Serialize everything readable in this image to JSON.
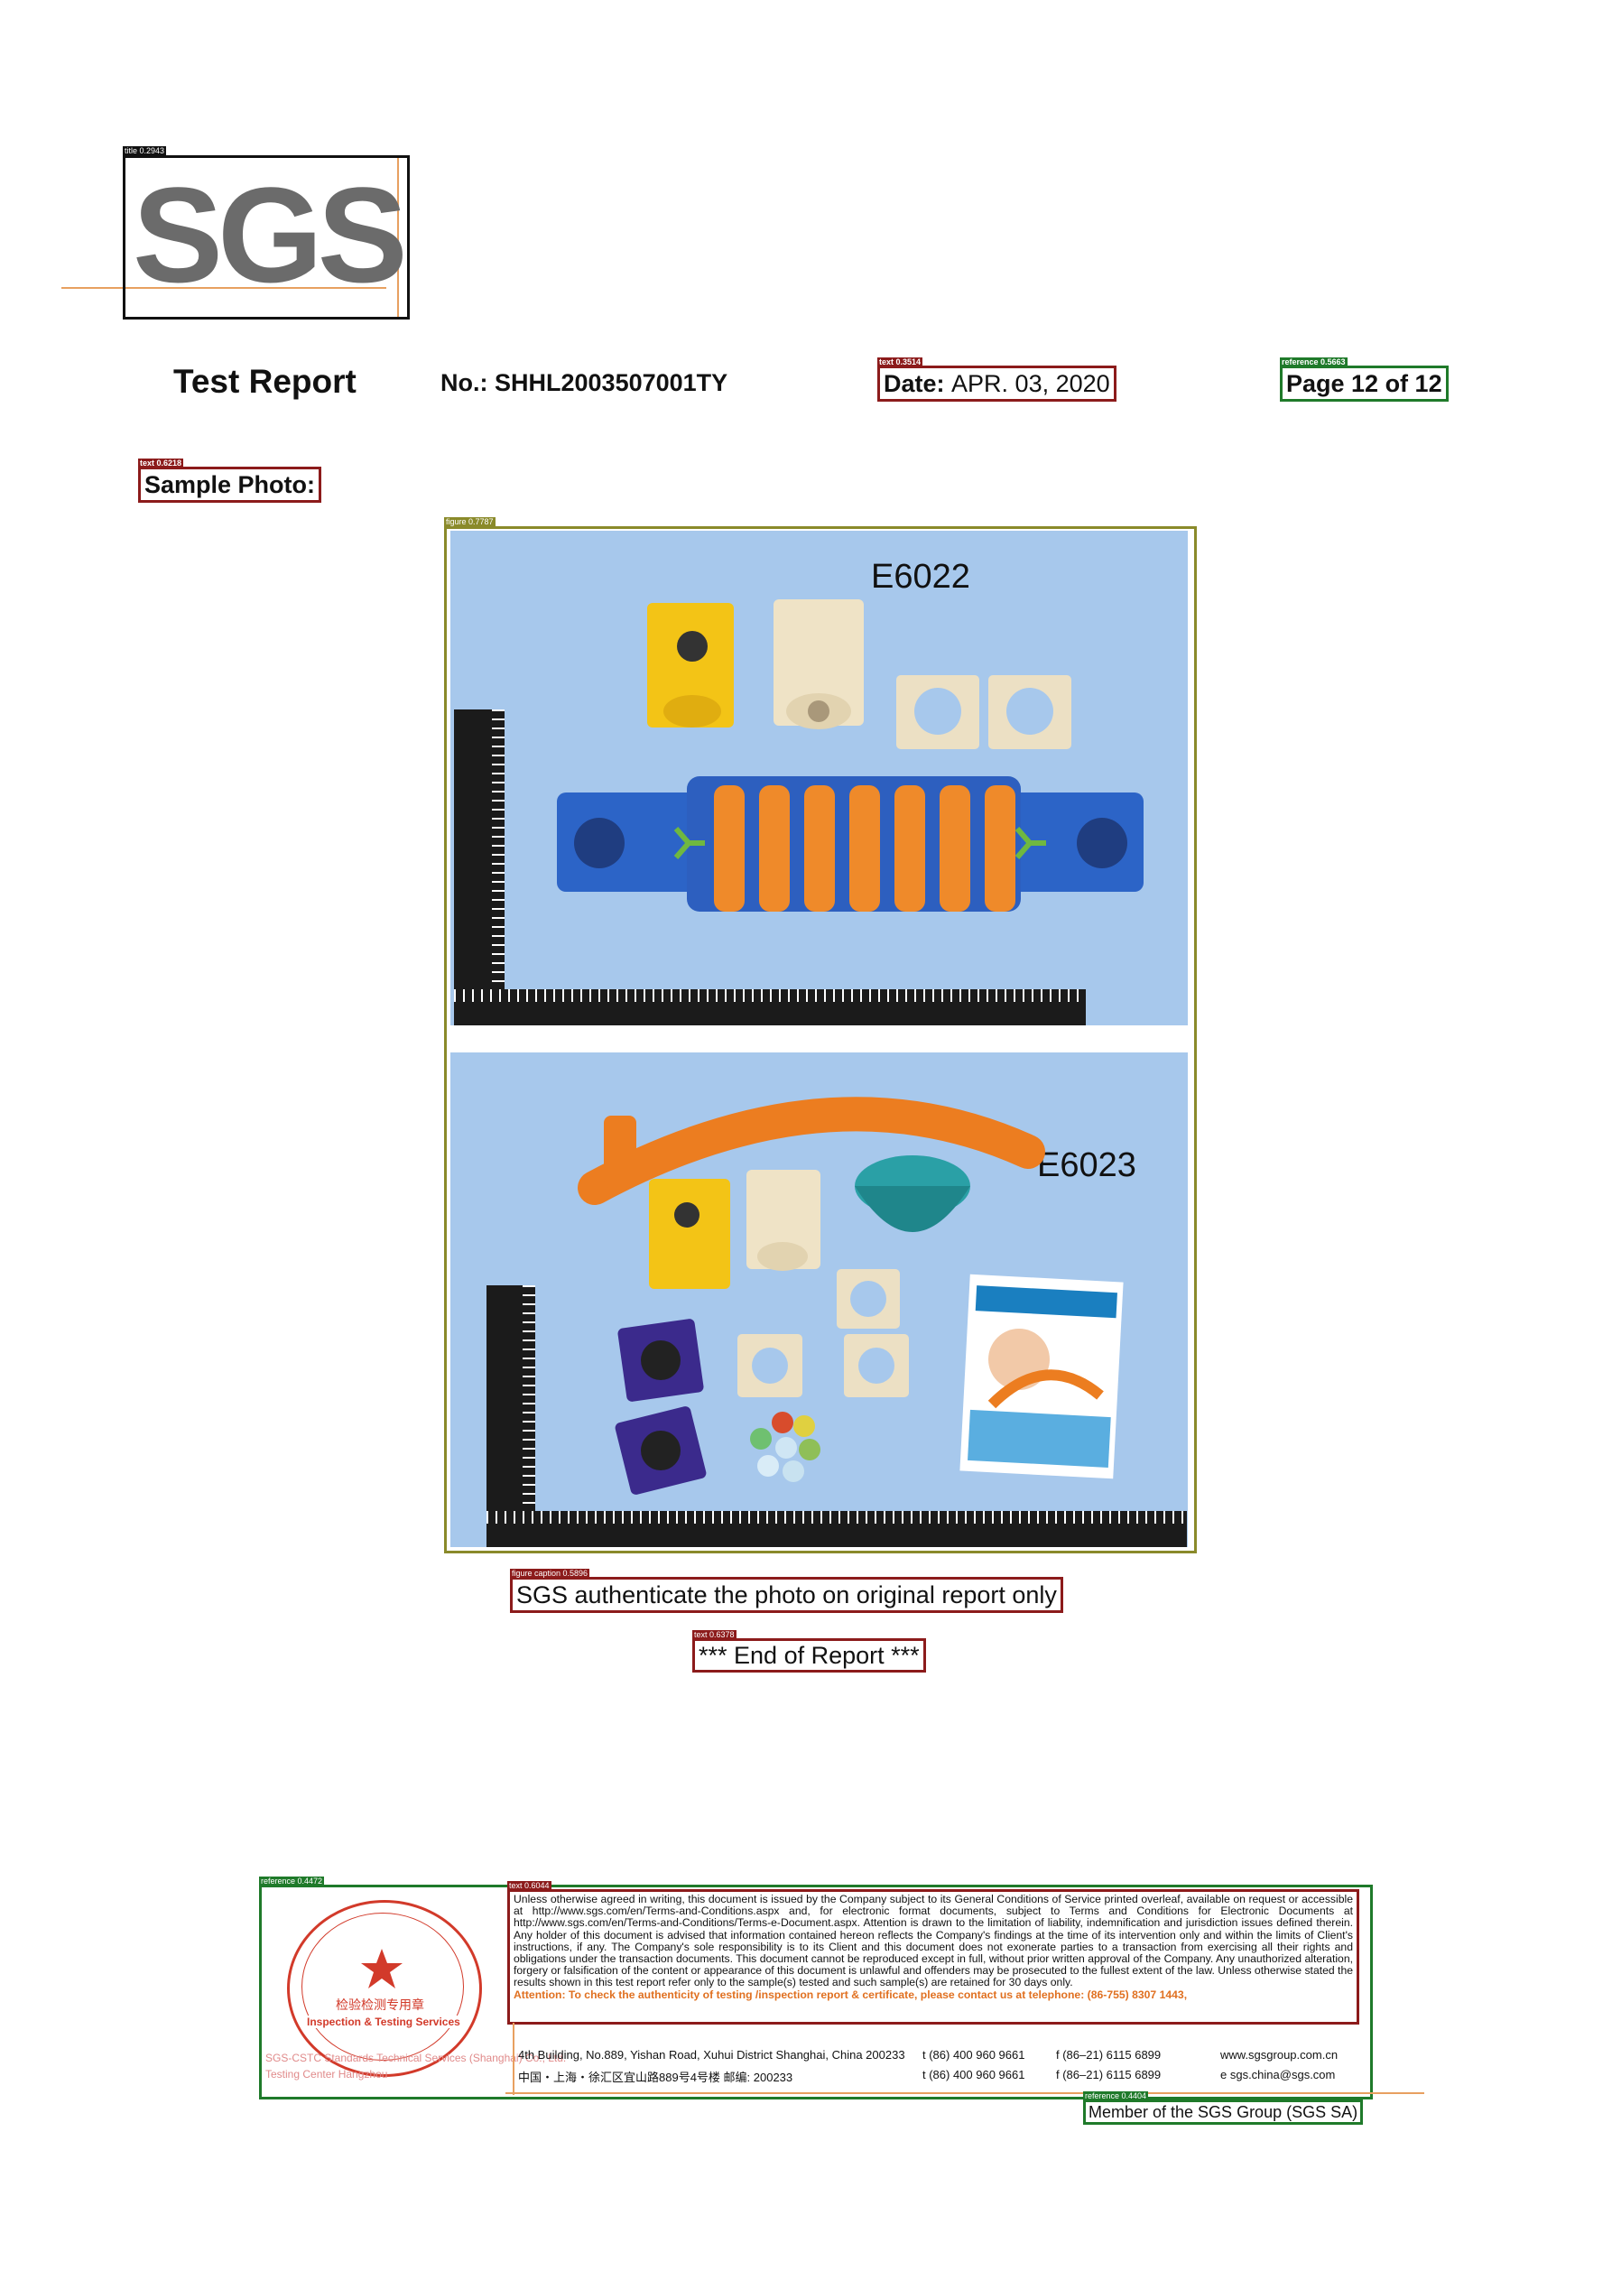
{
  "logo": {
    "text": "SGS"
  },
  "header": {
    "title": "Test Report",
    "number_label": "No.:",
    "number_value": "SHHL2003507001TY",
    "date_label": "Date:",
    "date_value": "APR. 03, 2020",
    "page_label": "Page 12 of 12"
  },
  "section": {
    "sample_photo_label": "Sample Photo:"
  },
  "photos": [
    {
      "model": "E6022"
    },
    {
      "model": "E6023"
    }
  ],
  "caption": "SGS authenticate the photo on original report only",
  "end_of_report": "*** End of Report ***",
  "footer": {
    "disclaimer": "Unless otherwise agreed in writing, this document is issued by the Company subject to its General Conditions of Service printed overleaf, available on request or accessible at http://www.sgs.com/en/Terms-and-Conditions.aspx and, for electronic format documents, subject to Terms and Conditions for Electronic Documents at http://www.sgs.com/en/Terms-and-Conditions/Terms-e-Document.aspx. Attention is drawn to the limitation of liability, indemnification and jurisdiction issues defined therein. Any holder of this document is advised that information contained hereon reflects the Company's findings at the time of its intervention only and within the limits of Client's instructions, if any. The Company's sole responsibility is to its Client and this document does not exonerate parties to a transaction from exercising all their rights and obligations under the transaction documents. This document cannot be reproduced except in full, without prior written approval of the Company. Any unauthorized alteration, forgery or falsification of the content or appearance of this document is unlawful and offenders may be prosecuted to the fullest extent of the law. Unless otherwise stated the results shown in this test report refer only to the sample(s) tested and such sample(s) are retained for 30 days only.",
    "attention": "Attention: To check the authenticity of testing /inspection report & certificate, please contact us at telephone: (86-755) 8307 1443,",
    "address_en": "4th Building, No.889, Yishan Road, Xuhui District Shanghai, China 200233",
    "address_cn": "中国・上海・徐汇区宜山路889号4号楼   邮编: 200233",
    "tel_1": "t (86) 400 960 9661",
    "fax_1": "f (86–21) 6115 6899",
    "web": "www.sgsgroup.com.cn",
    "tel_2": "t (86) 400 960 9661",
    "fax_2": "f (86–21) 6115 6899",
    "email": "e sgs.china@sgs.com",
    "member": "Member of the SGS Group (SGS SA)",
    "stamp_center": "检验检测专用章",
    "stamp_band": "Inspection & Testing Services",
    "stamp_company": "SGS-CSTC Standards Technical Services (Shanghai) Co., Ltd.",
    "stamp_center_en": "Testing Center Hangzhou"
  },
  "annotations": {
    "title_tag": "title 0.2943",
    "date_tag": "text 0.3514",
    "page_tag": "reference 0.5663",
    "sample_tag": "text 0.6218",
    "figure_tag": "figure 0.7787",
    "caption_tag": "figure caption 0.5896",
    "end_tag": "text 0.6378",
    "footer_ref_tag": "reference 0.4472",
    "footer_text_tag": "text 0.6044",
    "member_tag": "reference 0.4404"
  },
  "colors": {
    "annotation_red": "#8c1b1b",
    "annotation_green": "#1f7a2a",
    "annotation_olive": "#8a8a2a",
    "logo_gray": "#6b6b6b",
    "photo_bg": "#a7c8ec",
    "accent_orange": "#e8a060"
  }
}
